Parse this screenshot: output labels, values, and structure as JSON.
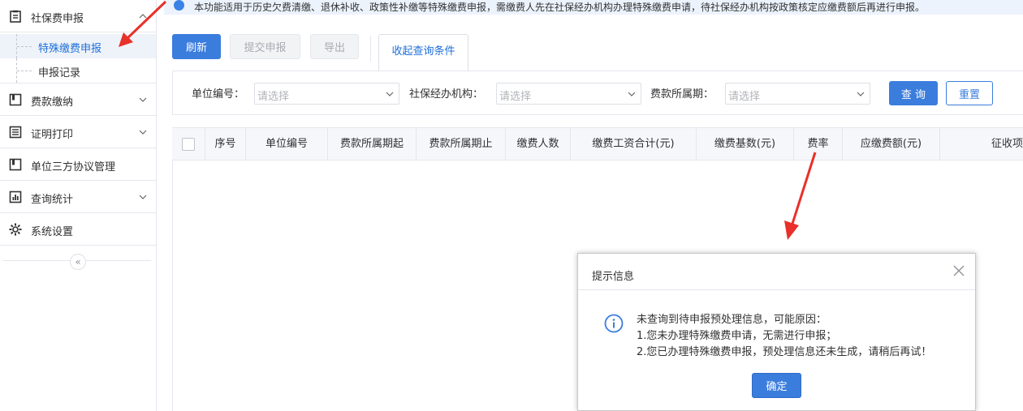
{
  "sidebar": {
    "items": [
      {
        "label": "社保费申报",
        "icon": "form-icon",
        "expanded": true
      },
      {
        "label": "费款缴纳",
        "icon": "book-icon"
      },
      {
        "label": "证明打印",
        "icon": "list-icon"
      },
      {
        "label": "单位三方协议管理",
        "icon": "book-icon"
      },
      {
        "label": "查询统计",
        "icon": "bar-chart-icon"
      },
      {
        "label": "系统设置",
        "icon": "gear-icon"
      }
    ],
    "sub_items": [
      {
        "label": "特殊缴费申报",
        "active": true
      },
      {
        "label": "申报记录",
        "active": false
      }
    ],
    "collapse_glyph": "«"
  },
  "notice": {
    "text": "本功能适用于历史欠费清缴、退休补收、政策性补缴等特殊缴费申报，需缴费人先在社保经办机构办理特殊缴费申请，待社保经办机构按政策核定应缴费额后再进行申报。"
  },
  "toolbar": {
    "refresh": "刷新",
    "submit": "提交申报",
    "export": "导出",
    "tab": "收起查询条件"
  },
  "filters": {
    "unit_code_label": "单位编号：",
    "agency_label": "社保经办机构：",
    "period_label": "费款所属期：",
    "placeholder": "请选择",
    "query": "查 询",
    "reset": "重置"
  },
  "table": {
    "columns": [
      "序号",
      "单位编号",
      "费款所属期起",
      "费款所属期止",
      "缴费人数",
      "缴费工资合计(元)",
      "缴费基数(元)",
      "费率",
      "应缴费额(元)",
      "征收项"
    ]
  },
  "dialog": {
    "title": "提示信息",
    "lines": [
      "未查询到待申报预处理信息，可能原因：",
      "1.您未办理特殊缴费申请，无需进行申报；",
      "2.您已办理特殊缴费申报，预处理信息还未生成，请稍后再试！"
    ],
    "ok": "确定"
  },
  "colors": {
    "primary": "#3b7ddd",
    "active_text": "#1e6fd9",
    "annotation_arrow": "#e8312a"
  }
}
